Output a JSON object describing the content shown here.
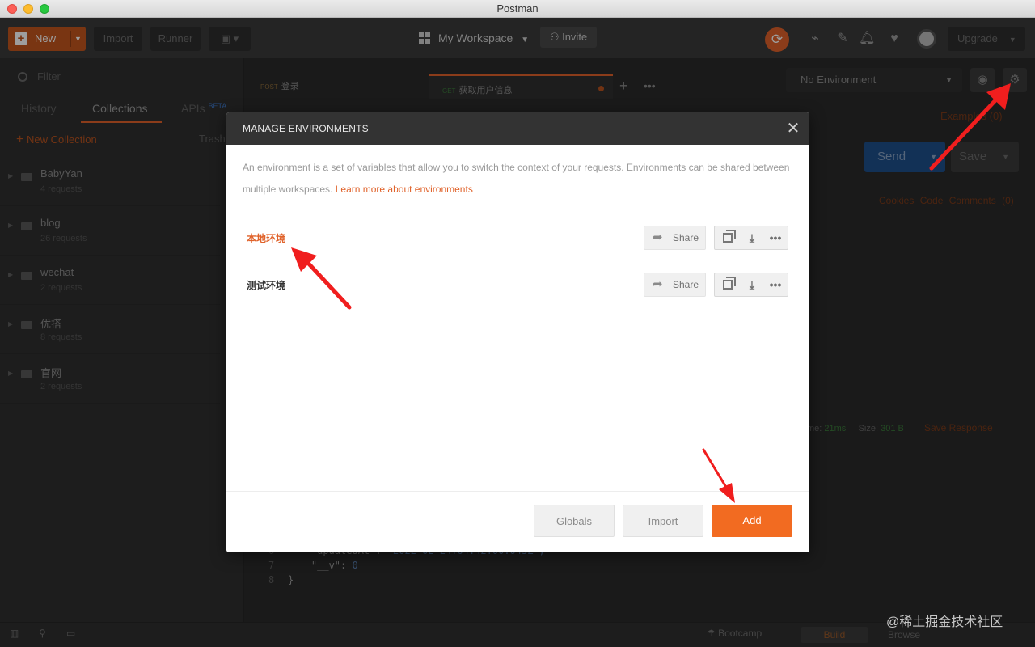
{
  "window": {
    "title": "Postman"
  },
  "toolbar": {
    "new_label": "New",
    "import_label": "Import",
    "runner_label": "Runner",
    "workspace_label": "My Workspace",
    "invite_label": "Invite",
    "upgrade_label": "Upgrade"
  },
  "sidebar": {
    "filter_placeholder": "Filter",
    "tabs": {
      "history": "History",
      "collections": "Collections",
      "apis": "APIs",
      "apis_badge": "BETA"
    },
    "new_collection": "New Collection",
    "trash": "Trash",
    "collections": [
      {
        "name": "BabyYan",
        "count": "4 requests"
      },
      {
        "name": "blog",
        "count": "26 requests"
      },
      {
        "name": "wechat",
        "count": "2 requests"
      },
      {
        "name": "优搭",
        "count": "8 requests"
      },
      {
        "name": "官网",
        "count": "2 requests"
      }
    ]
  },
  "main": {
    "tabs": [
      {
        "method": "POST",
        "name": "登录"
      },
      {
        "method": "GET",
        "name": "获取用户信息"
      }
    ],
    "environment_select": "No Environment",
    "examples": "Examples (0)",
    "send": "Send",
    "save": "Save",
    "links": {
      "cookies": "Cookies",
      "code": "Code",
      "comments": "Comments (0)"
    },
    "status": {
      "time_label": "me:",
      "time": "21ms",
      "size_label": "Size:",
      "size": "301 B",
      "save_response": "Save Response"
    },
    "code_lines": [
      {
        "n": "6",
        "key": "\"updatedAt\": ",
        "val": "\"2022-02-24T04:42:00.043Z\","
      },
      {
        "n": "7",
        "key": "\"__v\": ",
        "val": "0"
      },
      {
        "n": "8",
        "key": "}",
        "val": ""
      }
    ]
  },
  "modal": {
    "title": "MANAGE ENVIRONMENTS",
    "description": "An environment is a set of variables that allow you to switch the context of your requests. Environments can be shared between multiple workspaces.",
    "learn_more": "Learn more about environments",
    "environments": [
      {
        "name": "本地环境",
        "share": "Share",
        "color": "#e0622a"
      },
      {
        "name": "测试环境",
        "share": "Share",
        "color": "#333333"
      }
    ],
    "buttons": {
      "globals": "Globals",
      "import": "Import",
      "add": "Add"
    }
  },
  "footer": {
    "bootcamp": "Bootcamp",
    "build": "Build",
    "browse": "Browse"
  },
  "watermark": "@稀土掘金技术社区",
  "colors": {
    "accent": "#f26b21",
    "annotation": "#f01e1e",
    "send_blue": "#1d4f8c"
  }
}
